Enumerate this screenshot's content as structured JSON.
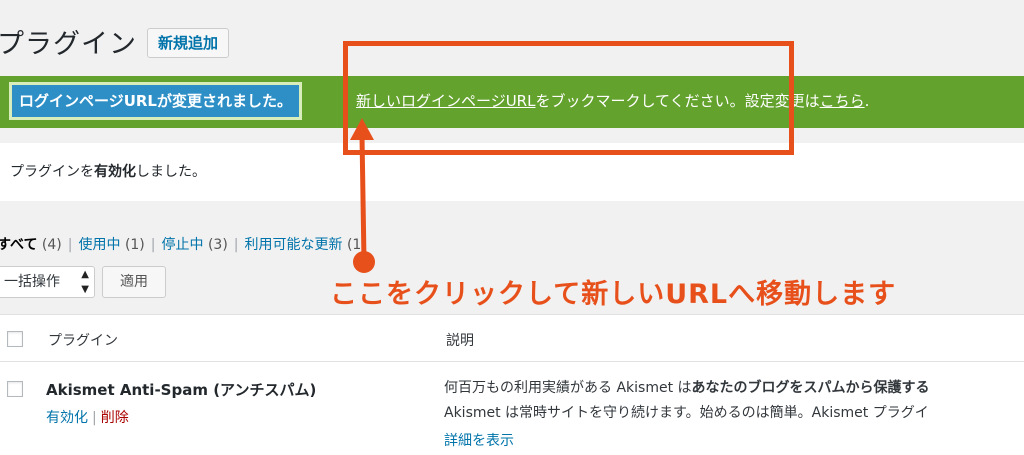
{
  "header": {
    "title": "プラグイン",
    "add_new_label": "新規追加"
  },
  "notice": {
    "badge": "ログインページURLが変更されました。",
    "link_new_url": "新しいログインページURL",
    "middle_text": "をブックマークしてください。設定変更は",
    "link_here": "こちら",
    "end_text": "."
  },
  "activated_notice": {
    "prefix": "プラグインを",
    "bold": "有効化",
    "suffix": "しました。"
  },
  "filters": {
    "all_label": "すべて",
    "all_count": "(4)",
    "active_label": "使用中",
    "active_count": "(1)",
    "inactive_label": "停止中",
    "inactive_count": "(3)",
    "update_label": "利用可能な更新",
    "update_count": "(1)"
  },
  "bulk": {
    "selected": "一括操作",
    "apply_label": "適用"
  },
  "table": {
    "col_plugin": "プラグイン",
    "col_description": "説明",
    "rows": [
      {
        "name": "Akismet Anti-Spam (アンチスパム)",
        "action_activate": "有効化",
        "action_delete": "削除",
        "desc_line1_prefix": "何百万もの利用実績がある Akismet は",
        "desc_line1_bold": "あなたのブログをスパムから保護する",
        "desc_line2": "Akismet は常時サイトを守り続けます。始めるのは簡単。Akismet プラグイ",
        "desc_line3_link": "詳細を表示"
      }
    ]
  },
  "annotation": {
    "text": "ここをクリックして新しいURLへ移動します",
    "color": "#e8501b"
  },
  "colors": {
    "notice_green": "#64a22e",
    "badge_blue": "#2d8fc6",
    "link_blue": "#0073aa",
    "delete_red": "#aa0000"
  }
}
